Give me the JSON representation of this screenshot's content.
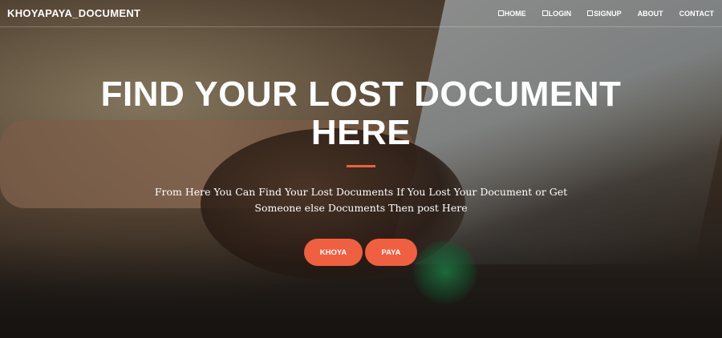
{
  "navbar": {
    "brand": "KHOYAPAYA_DOCUMENT",
    "items": [
      {
        "label": "HOME",
        "icon": "home-icon"
      },
      {
        "label": "LOGIN",
        "icon": "login-icon"
      },
      {
        "label": "SIGNUP",
        "icon": "signup-icon"
      },
      {
        "label": "ABOUT"
      },
      {
        "label": "CONTACT"
      }
    ]
  },
  "hero": {
    "title": "FIND YOUR LOST DOCUMENT HERE",
    "subtitle_line1": "From Here You Can Find Your Lost Documents If You Lost Your Document or Get",
    "subtitle_line2": "Someone else Documents Then post Here",
    "buttons": [
      {
        "label": "KHOYA"
      },
      {
        "label": "PAYA"
      }
    ]
  },
  "colors": {
    "accent": "#f05f40",
    "text": "#ffffff"
  }
}
